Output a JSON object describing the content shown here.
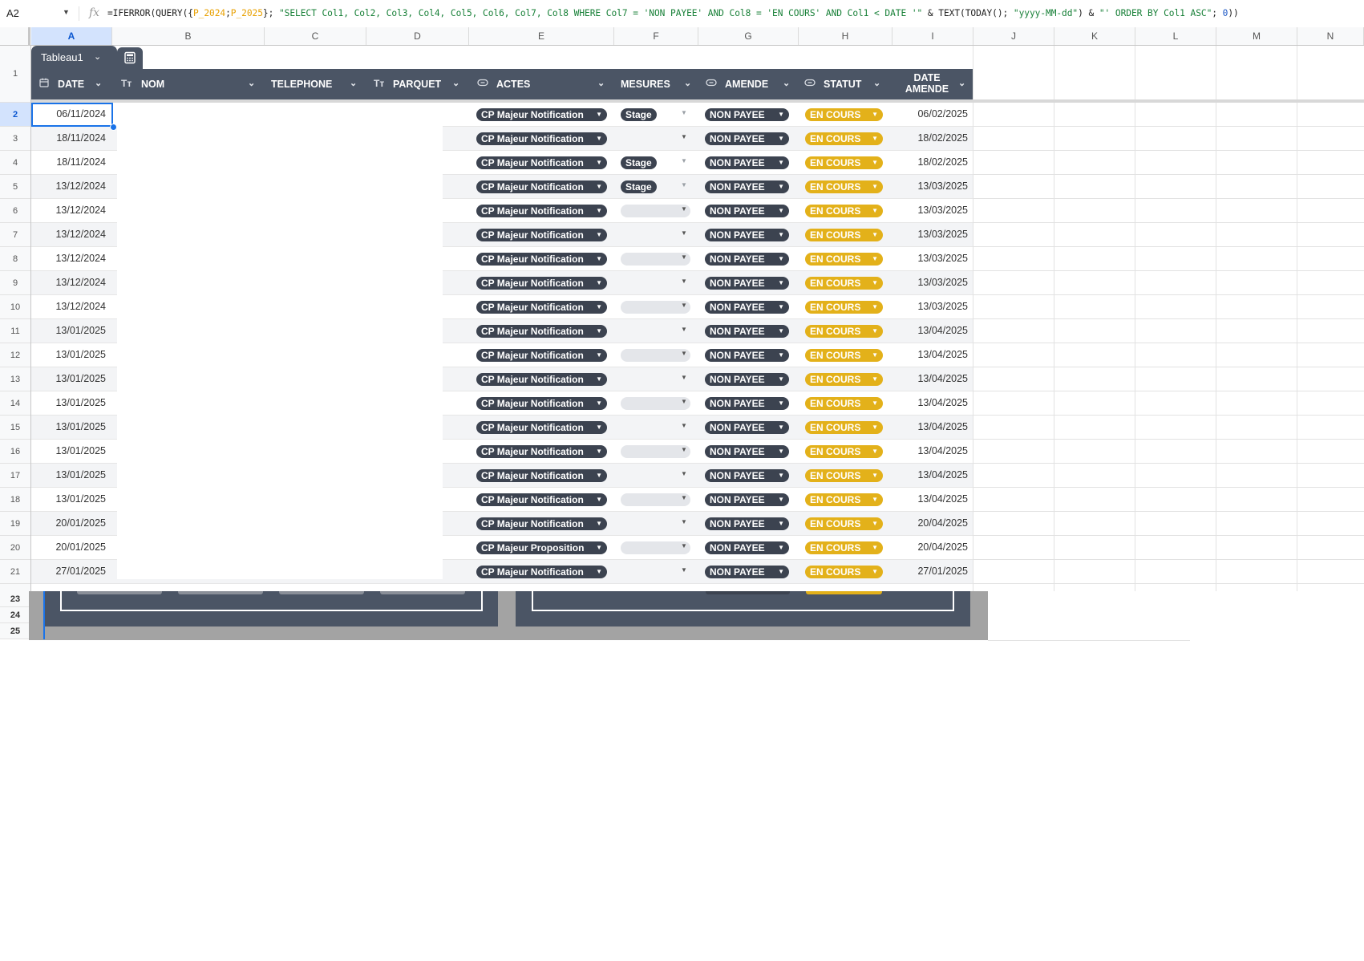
{
  "formula_bar": {
    "cell_ref": "A2",
    "fx_icon": "fx-icon",
    "formula_parts": [
      {
        "t": "=IFERROR(QUERY({",
        "c": "plain"
      },
      {
        "t": "P_2024",
        "c": "r1"
      },
      {
        "t": ";",
        "c": "plain"
      },
      {
        "t": "P_2025",
        "c": "r2"
      },
      {
        "t": "}; ",
        "c": "plain"
      },
      {
        "t": "\"SELECT Col1, Col2, Col3, Col4, Col5, Col6, Col7, Col8 WHERE Col7 = 'NON PAYEE' AND Col8 = 'EN COURS' AND Col1 < DATE '\"",
        "c": "str"
      },
      {
        "t": " & TEXT(TODAY(); ",
        "c": "plain"
      },
      {
        "t": "\"yyyy-MM-dd\"",
        "c": "str"
      },
      {
        "t": ") & ",
        "c": "plain"
      },
      {
        "t": "\"' ORDER BY Col1 ASC\"",
        "c": "str"
      },
      {
        "t": "; ",
        "c": "plain"
      },
      {
        "t": "0",
        "c": "num"
      },
      {
        "t": "))",
        "c": "plain"
      }
    ]
  },
  "columns": [
    "A",
    "B",
    "C",
    "D",
    "E",
    "F",
    "G",
    "H",
    "I",
    "J",
    "K",
    "L",
    "M",
    "N"
  ],
  "selected_column": "A",
  "row_numbers_top": [
    "1",
    "2",
    "3",
    "4",
    "5",
    "6",
    "7",
    "8",
    "9",
    "10",
    "11",
    "12",
    "13",
    "14",
    "15",
    "16",
    "17",
    "18",
    "19",
    "20",
    "21"
  ],
  "row_numbers_bottom": [
    "23",
    "24",
    "25"
  ],
  "selected_row": "2",
  "table": {
    "name": "Tableau1",
    "calc_icon": "calculator-icon",
    "headers": {
      "date": "DATE",
      "nom": "NOM",
      "telephone": "TELEPHONE",
      "parquet": "PARQUET",
      "actes": "ACTES",
      "mesures": "MESURES",
      "amende": "AMENDE",
      "statut": "STATUT",
      "date_amende_line1": "DATE",
      "date_amende_line2": "AMENDE"
    },
    "rows": [
      {
        "date": "06/11/2024",
        "acte": "CP Majeur Notification",
        "mesure": "Stage",
        "mbox": "none",
        "amende": "NON PAYEE",
        "statut": "EN COURS",
        "date_amende": "06/02/2025"
      },
      {
        "date": "18/11/2024",
        "acte": "CP Majeur Notification",
        "mesure": "",
        "mbox": "none",
        "amende": "NON PAYEE",
        "statut": "EN COURS",
        "date_amende": "18/02/2025"
      },
      {
        "date": "18/11/2024",
        "acte": "CP Majeur Notification",
        "mesure": "Stage",
        "mbox": "none",
        "amende": "NON PAYEE",
        "statut": "EN COURS",
        "date_amende": "18/02/2025"
      },
      {
        "date": "13/12/2024",
        "acte": "CP Majeur Notification",
        "mesure": "Stage",
        "mbox": "none",
        "amende": "NON PAYEE",
        "statut": "EN COURS",
        "date_amende": "13/03/2025"
      },
      {
        "date": "13/12/2024",
        "acte": "CP Majeur Notification",
        "mesure": "",
        "mbox": "filled",
        "amende": "NON PAYEE",
        "statut": "EN COURS",
        "date_amende": "13/03/2025"
      },
      {
        "date": "13/12/2024",
        "acte": "CP Majeur Notification",
        "mesure": "",
        "mbox": "none",
        "amende": "NON PAYEE",
        "statut": "EN COURS",
        "date_amende": "13/03/2025"
      },
      {
        "date": "13/12/2024",
        "acte": "CP Majeur Notification",
        "mesure": "",
        "mbox": "filled",
        "amende": "NON PAYEE",
        "statut": "EN COURS",
        "date_amende": "13/03/2025"
      },
      {
        "date": "13/12/2024",
        "acte": "CP Majeur Notification",
        "mesure": "",
        "mbox": "none",
        "amende": "NON PAYEE",
        "statut": "EN COURS",
        "date_amende": "13/03/2025"
      },
      {
        "date": "13/12/2024",
        "acte": "CP Majeur Notification",
        "mesure": "",
        "mbox": "filled",
        "amende": "NON PAYEE",
        "statut": "EN COURS",
        "date_amende": "13/03/2025"
      },
      {
        "date": "13/01/2025",
        "acte": "CP Majeur Notification",
        "mesure": "",
        "mbox": "none",
        "amende": "NON PAYEE",
        "statut": "EN COURS",
        "date_amende": "13/04/2025"
      },
      {
        "date": "13/01/2025",
        "acte": "CP Majeur Notification",
        "mesure": "",
        "mbox": "filled",
        "amende": "NON PAYEE",
        "statut": "EN COURS",
        "date_amende": "13/04/2025"
      },
      {
        "date": "13/01/2025",
        "acte": "CP Majeur Notification",
        "mesure": "",
        "mbox": "none",
        "amende": "NON PAYEE",
        "statut": "EN COURS",
        "date_amende": "13/04/2025"
      },
      {
        "date": "13/01/2025",
        "acte": "CP Majeur Notification",
        "mesure": "",
        "mbox": "filled",
        "amende": "NON PAYEE",
        "statut": "EN COURS",
        "date_amende": "13/04/2025"
      },
      {
        "date": "13/01/2025",
        "acte": "CP Majeur Notification",
        "mesure": "",
        "mbox": "none",
        "amende": "NON PAYEE",
        "statut": "EN COURS",
        "date_amende": "13/04/2025"
      },
      {
        "date": "13/01/2025",
        "acte": "CP Majeur Notification",
        "mesure": "",
        "mbox": "filled",
        "amende": "NON PAYEE",
        "statut": "EN COURS",
        "date_amende": "13/04/2025"
      },
      {
        "date": "13/01/2025",
        "acte": "CP Majeur Notification",
        "mesure": "",
        "mbox": "none",
        "amende": "NON PAYEE",
        "statut": "EN COURS",
        "date_amende": "13/04/2025"
      },
      {
        "date": "13/01/2025",
        "acte": "CP Majeur Notification",
        "mesure": "",
        "mbox": "filled",
        "amende": "NON PAYEE",
        "statut": "EN COURS",
        "date_amende": "13/04/2025"
      },
      {
        "date": "20/01/2025",
        "acte": "CP Majeur Notification",
        "mesure": "",
        "mbox": "none",
        "amende": "NON PAYEE",
        "statut": "EN COURS",
        "date_amende": "20/04/2025"
      },
      {
        "date": "20/01/2025",
        "acte": "CP Majeur Proposition",
        "mesure": "",
        "mbox": "filled",
        "amende": "NON PAYEE",
        "statut": "EN COURS",
        "date_amende": "20/04/2025"
      },
      {
        "date": "27/01/2025",
        "acte": "CP Majeur Notification",
        "mesure": "",
        "mbox": "none",
        "amende": "NON PAYEE",
        "statut": "EN COURS",
        "date_amende": "27/01/2025"
      }
    ]
  },
  "colors": {
    "table_header": "#4b5565",
    "chip_dark": "#3c4350",
    "chip_gold": "#e3b11a",
    "selection": "#1a73e8",
    "row_alt": "#f3f4f6"
  }
}
